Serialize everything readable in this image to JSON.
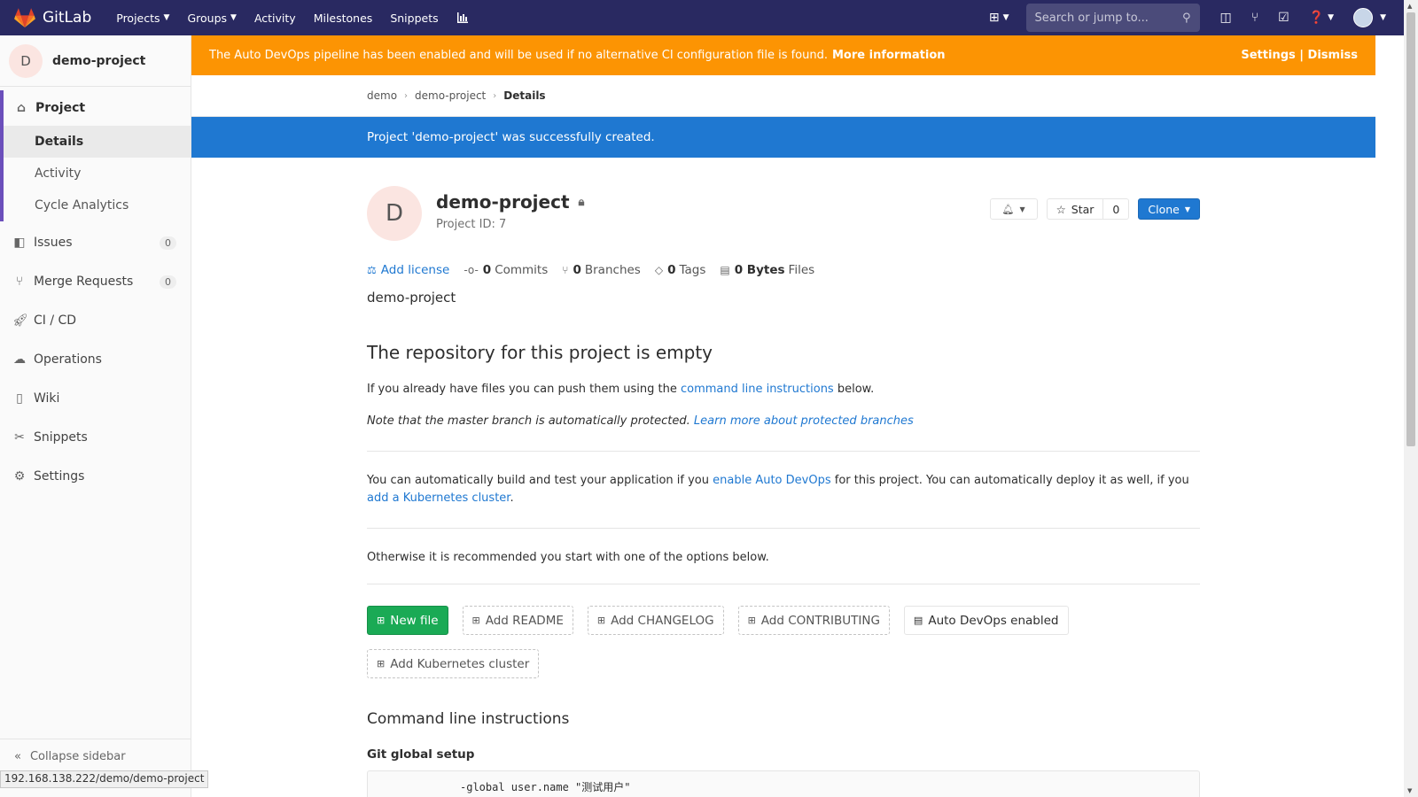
{
  "navbar": {
    "brand": "GitLab",
    "links": [
      {
        "label": "Projects",
        "dropdown": true
      },
      {
        "label": "Groups",
        "dropdown": true
      },
      {
        "label": "Activity",
        "dropdown": false
      },
      {
        "label": "Milestones",
        "dropdown": false
      },
      {
        "label": "Snippets",
        "dropdown": false
      }
    ],
    "search_placeholder": "Search or jump to...",
    "bg_color": "#292961"
  },
  "sidebar": {
    "project_initial": "D",
    "project_name": "demo-project",
    "project_section": "Project",
    "project_subitems": [
      "Details",
      "Activity",
      "Cycle Analytics"
    ],
    "items": [
      {
        "label": "Issues",
        "icon": "issues-icon",
        "badge": "0"
      },
      {
        "label": "Merge Requests",
        "icon": "merge-request-icon",
        "badge": "0"
      },
      {
        "label": "CI / CD",
        "icon": "rocket-icon"
      },
      {
        "label": "Operations",
        "icon": "operations-icon"
      },
      {
        "label": "Wiki",
        "icon": "book-icon"
      },
      {
        "label": "Snippets",
        "icon": "scissors-icon"
      },
      {
        "label": "Settings",
        "icon": "gear-icon"
      }
    ],
    "collapse_label": "Collapse sidebar"
  },
  "alert": {
    "text": "The Auto DevOps pipeline has been enabled and will be used if no alternative CI configuration file is found.",
    "link": "More information",
    "actions": "Settings | Dismiss",
    "color": "#fc9403"
  },
  "breadcrumbs": {
    "items": [
      "demo",
      "demo-project"
    ],
    "current": "Details"
  },
  "flash": {
    "text": "Project 'demo-project' was successfully created.",
    "color": "#1f78d1"
  },
  "project": {
    "initial": "D",
    "name": "demo-project",
    "id_label": "Project ID: 7",
    "star_label": "Star",
    "star_count": "0",
    "clone_label": "Clone",
    "description": "demo-project",
    "stats": {
      "add_license": "Add license",
      "commits_count": "0",
      "commits_label": "Commits",
      "branches_count": "0",
      "branches_label": "Branches",
      "tags_count": "0",
      "tags_label": "Tags",
      "files_size": "0 Bytes",
      "files_label": "Files"
    }
  },
  "empty_repo": {
    "title": "The repository for this project is empty",
    "push_text_1": "If you already have files you can push them using the",
    "push_link": "command line instructions",
    "push_text_2": "below.",
    "note_text": "Note that the master branch is automatically protected.",
    "note_link": "Learn more about protected branches",
    "devops_text_1": "You can automatically build and test your application if you",
    "devops_link_1": "enable Auto DevOps",
    "devops_text_2": "for this project. You can automatically deploy it as well, if you",
    "devops_link_2": "add a Kubernetes cluster",
    "devops_text_3": ".",
    "options_text": "Otherwise it is recommended you start with one of the options below.",
    "buttons": {
      "new_file": "New file",
      "add_readme": "Add README",
      "add_changelog": "Add CHANGELOG",
      "add_contributing": "Add CONTRIBUTING",
      "auto_devops": "Auto DevOps enabled",
      "add_k8s": "Add Kubernetes cluster"
    },
    "cmd_title": "Command line instructions",
    "git_setup_title": "Git global setup",
    "code_line": "-global user.name \"测试用户\""
  },
  "statusbar": {
    "url": "192.168.138.222/demo/demo-project"
  }
}
